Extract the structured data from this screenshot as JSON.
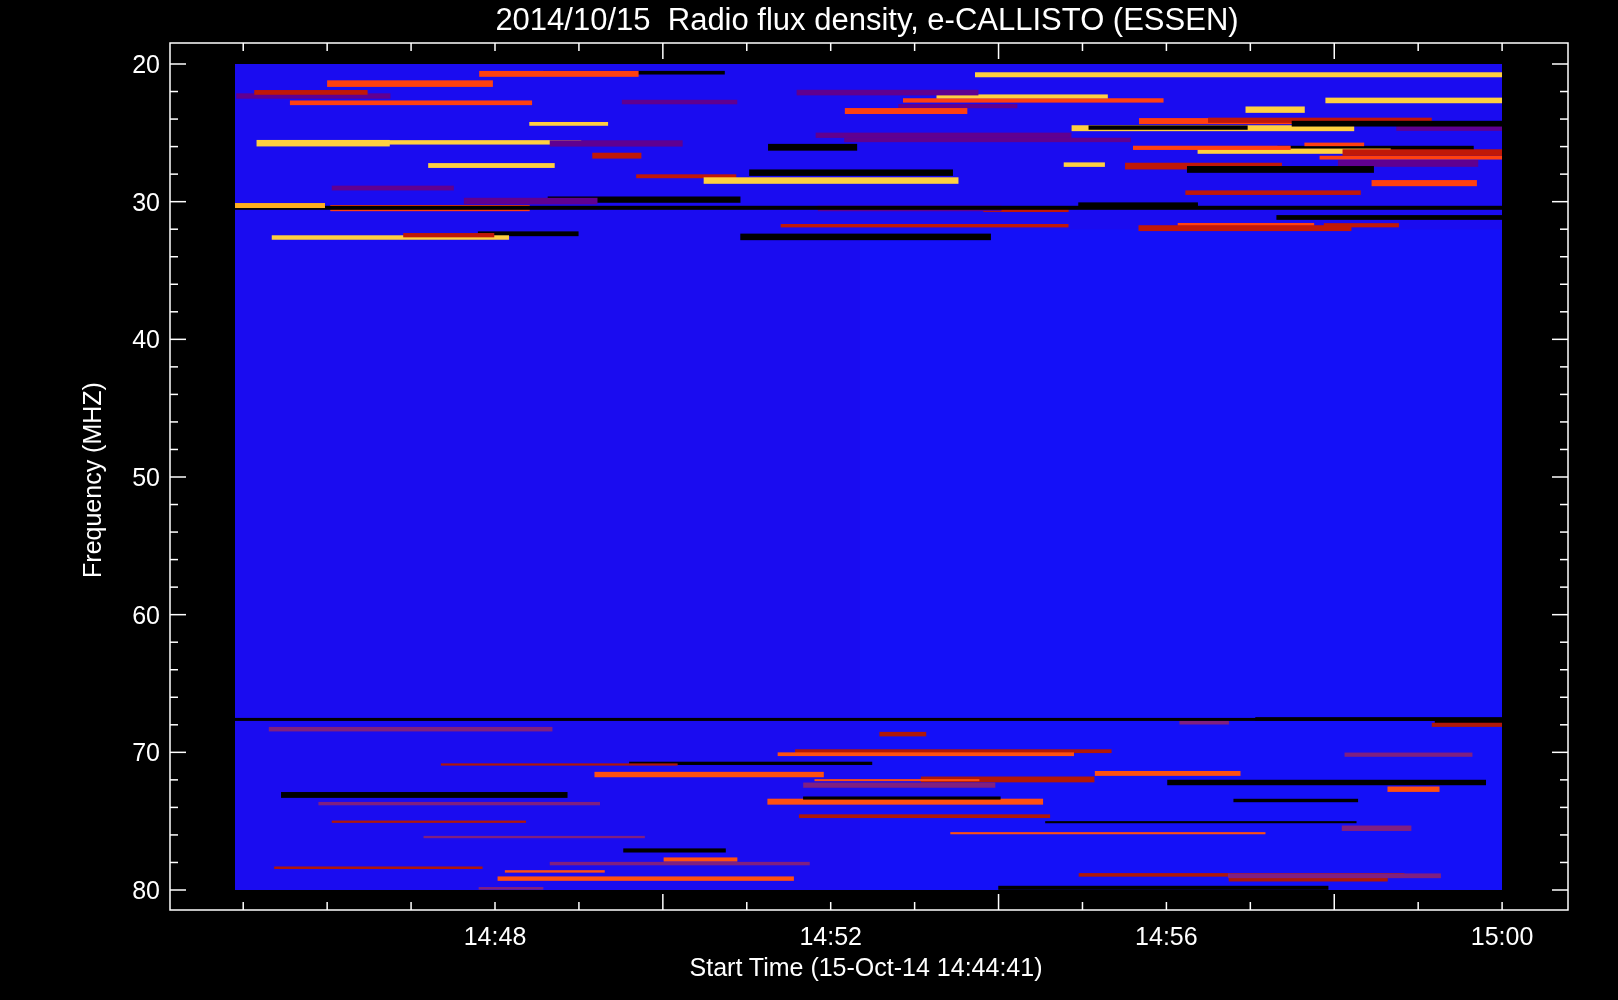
{
  "title": "2014/10/15  Radio flux density, e-CALLISTO (ESSEN)",
  "plot": {
    "ylabel": "Frequency (MHZ)",
    "xlabel": "Start Time (15-Oct-14 14:44:41)",
    "yticks": [
      "20",
      "30",
      "40",
      "50",
      "60",
      "70",
      "80"
    ],
    "xticks": [
      "14:48",
      "14:52",
      "14:56",
      "15:00"
    ]
  }
}
